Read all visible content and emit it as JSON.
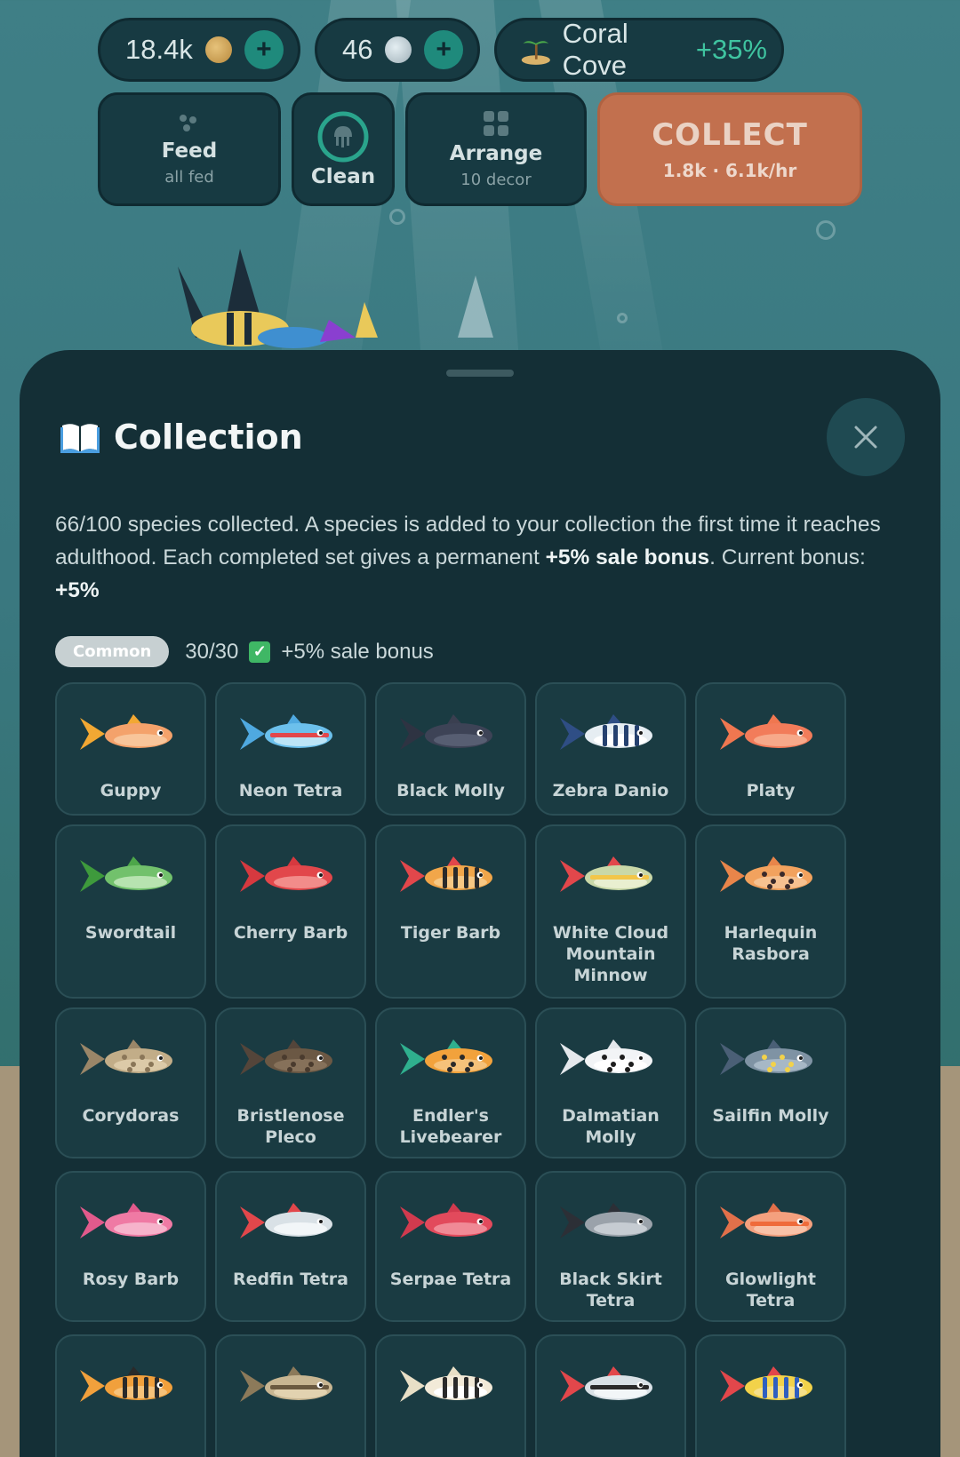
{
  "hud": {
    "coins": {
      "value": "18.4k",
      "plus": "+"
    },
    "pearls": {
      "value": "46",
      "plus": "+"
    },
    "location": {
      "name": "Coral Cove",
      "bonus": "+35%"
    }
  },
  "actions": {
    "feed": {
      "label": "Feed",
      "sub": "all fed"
    },
    "clean": {
      "label": "Clean"
    },
    "arrange": {
      "label": "Arrange",
      "sub": "10 decor"
    },
    "collect": {
      "label": "COLLECT",
      "sub": "1.8k · 6.1k/hr"
    }
  },
  "panel": {
    "title": "Collection",
    "desc_part1": "66/100 species collected. A species is added to your collection the first time it reaches adulthood. Each completed set gives a permanent ",
    "desc_bold1": "+5% sale bonus",
    "desc_part2": ". Current bonus: ",
    "desc_bold2": "+5%",
    "set": {
      "name": "Common",
      "progress": "30/30",
      "bonus": "+5% sale bonus"
    }
  },
  "fish": [
    {
      "name": "Guppy",
      "body": "#f4a26b",
      "belly": "#f8c59a",
      "fin": "#f2a833",
      "tail": "#f2a833",
      "pattern": "none"
    },
    {
      "name": "Neon Tetra",
      "body": "#6cc0ec",
      "belly": "#bde5f7",
      "fin": "#4fa9e0",
      "tail": "#4fa9e0",
      "pattern": "stripe",
      "stripe": "#e2474b"
    },
    {
      "name": "Black Molly",
      "body": "#3d4356",
      "belly": "#575e72",
      "fin": "#3a3f50",
      "tail": "#2e3342",
      "pattern": "none"
    },
    {
      "name": "Zebra Danio",
      "body": "#e6edf2",
      "belly": "#ffffff",
      "fin": "#2f4e85",
      "tail": "#2f4e85",
      "pattern": "bars",
      "stripe": "#25406e"
    },
    {
      "name": "Platy",
      "body": "#f27c5a",
      "belly": "#f7a98a",
      "fin": "#f07750",
      "tail": "#f07750",
      "pattern": "none"
    },
    {
      "name": "Swordtail",
      "body": "#72c16c",
      "belly": "#b7e3b0",
      "fin": "#4da64a",
      "tail": "#3e9a3c",
      "pattern": "none"
    },
    {
      "name": "Cherry Barb",
      "body": "#e2474b",
      "belly": "#f28c8a",
      "fin": "#d6393f",
      "tail": "#d6393f",
      "pattern": "none"
    },
    {
      "name": "Tiger Barb",
      "body": "#f1a64a",
      "belly": "#f7c884",
      "fin": "#e2474b",
      "tail": "#e2474b",
      "pattern": "bars",
      "stripe": "#2a2a2a"
    },
    {
      "name": "White Cloud Mountain Minnow",
      "body": "#c9d8a8",
      "belly": "#e9efd0",
      "fin": "#e2474b",
      "tail": "#e2474b",
      "pattern": "stripe",
      "stripe": "#f2c64a"
    },
    {
      "name": "Harlequin Rasbora",
      "body": "#f2a25e",
      "belly": "#f6c190",
      "fin": "#e8854a",
      "tail": "#e8854a",
      "pattern": "dots",
      "stripe": "#3a2a2a"
    },
    {
      "name": "Corydoras",
      "body": "#c2ad88",
      "belly": "#dccaa8",
      "fin": "#9a8668",
      "tail": "#9a8668",
      "pattern": "dots",
      "stripe": "#8a7658"
    },
    {
      "name": "Bristlenose Pleco",
      "body": "#6b5844",
      "belly": "#86715a",
      "fin": "#54453a",
      "tail": "#54453a",
      "pattern": "dots",
      "stripe": "#4a3b2e"
    },
    {
      "name": "Endler's Livebearer",
      "body": "#f2a23c",
      "belly": "#f6c27a",
      "fin": "#2fb08e",
      "tail": "#2fb08e",
      "pattern": "dots",
      "stripe": "#2a2a2a"
    },
    {
      "name": "Dalmatian Molly",
      "body": "#f2f4f6",
      "belly": "#ffffff",
      "fin": "#e4e8ec",
      "tail": "#e4e8ec",
      "pattern": "dots",
      "stripe": "#1e1e1e"
    },
    {
      "name": "Sailfin Molly",
      "body": "#7f93a4",
      "belly": "#a7b8c6",
      "fin": "#4a5f76",
      "tail": "#4a5f76",
      "pattern": "dots",
      "stripe": "#f2d24a"
    },
    {
      "name": "Rosy Barb",
      "body": "#ef7aa4",
      "belly": "#f6b3cb",
      "fin": "#e25a8c",
      "tail": "#e25a8c",
      "pattern": "none"
    },
    {
      "name": "Redfin Tetra",
      "body": "#d9e1e6",
      "belly": "#f2f6f8",
      "fin": "#e2474b",
      "tail": "#e2474b",
      "pattern": "none"
    },
    {
      "name": "Serpae Tetra",
      "body": "#e24a5c",
      "belly": "#f08a96",
      "fin": "#d13a4e",
      "tail": "#d13a4e",
      "pattern": "none"
    },
    {
      "name": "Black Skirt Tetra",
      "body": "#9aa2aa",
      "belly": "#c6ccd2",
      "fin": "#2c2f36",
      "tail": "#2c2f36",
      "pattern": "none"
    },
    {
      "name": "Glowlight Tetra",
      "body": "#f4a07e",
      "belly": "#f8c2a8",
      "fin": "#e2704a",
      "tail": "#e2704a",
      "pattern": "stripe",
      "stripe": "#ef6b3a"
    },
    {
      "name": "",
      "body": "#f1a03c",
      "belly": "#f6c27a",
      "fin": "#2a2a2a",
      "tail": "#f1a03c",
      "pattern": "bars",
      "stripe": "#2a2a2a"
    },
    {
      "name": "",
      "body": "#c8b692",
      "belly": "#e2d2b0",
      "fin": "#8c7a5a",
      "tail": "#8c7a5a",
      "pattern": "stripe",
      "stripe": "#6b5a40"
    },
    {
      "name": "",
      "body": "#f2ead8",
      "belly": "#ffffff",
      "fin": "#e8dfc6",
      "tail": "#e8dfc6",
      "pattern": "bars",
      "stripe": "#2a2a2a"
    },
    {
      "name": "",
      "body": "#d9e1e6",
      "belly": "#f2f6f8",
      "fin": "#e2474b",
      "tail": "#e2474b",
      "pattern": "stripe",
      "stripe": "#2a2a2a"
    },
    {
      "name": "",
      "body": "#f2d24a",
      "belly": "#f6e08a",
      "fin": "#e2474b",
      "tail": "#e2474b",
      "pattern": "bars",
      "stripe": "#2f5fbf"
    }
  ],
  "icons": {
    "coin": "gold-coin-icon",
    "pearl": "pearl-icon",
    "island": "island-icon",
    "feed": "food-pellets-icon",
    "clean": "jellyfish-clean-icon",
    "arrange": "grid-arrange-icon",
    "book": "open-book-icon",
    "close": "close-icon"
  }
}
